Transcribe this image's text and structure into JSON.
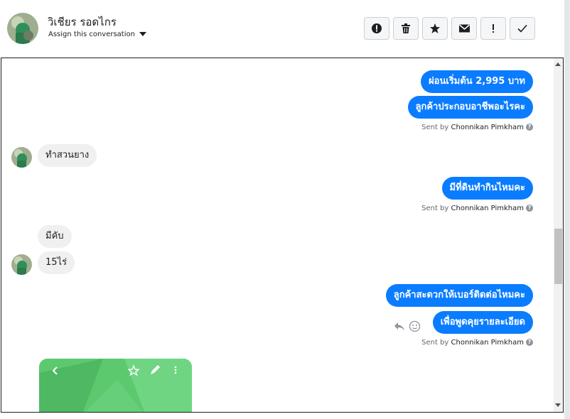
{
  "header": {
    "contact_name": "วิเชียร รอดไกร",
    "assign_label": "Assign this conversation",
    "actions": [
      {
        "icon": "exclamation-circle-icon",
        "name": "mark-spam-button"
      },
      {
        "icon": "trash-icon",
        "name": "delete-button"
      },
      {
        "icon": "star-icon",
        "name": "star-button"
      },
      {
        "icon": "envelope-icon",
        "name": "mark-unread-button"
      },
      {
        "icon": "exclamation-icon",
        "name": "follow-up-button"
      },
      {
        "icon": "check-icon",
        "name": "mark-done-button"
      }
    ]
  },
  "colors": {
    "outgoing_bubble": "#0a7cff",
    "incoming_bubble": "#f0f0f0"
  },
  "messages": {
    "m1": "ผ่อนเริ่มต้น 2,995 บาท",
    "m2": "ลูกค้าประกอบอาชีพอะไรคะ",
    "m3": "ทำสวนยาง",
    "m4": "มีที่ดินทำกินไหมคะ",
    "m5": "มีคับ",
    "m6": "15ไร่",
    "m7": "ลูกค้าสะดวกให้เบอร์ติดต่อไหมคะ",
    "m8": "เพื่อพูดคุยรายละเอียด"
  },
  "sent_by": {
    "prefix": "Sent by",
    "agent": "Chonnikan Pimkham",
    "help_glyph": "?"
  }
}
